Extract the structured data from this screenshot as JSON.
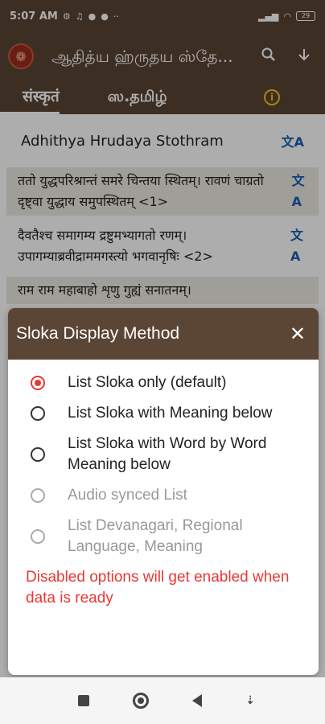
{
  "status_bar": {
    "time": "5:07 AM",
    "battery": "29"
  },
  "app_bar": {
    "title": "ஆதித்ய ஹ்ருதய ஸ்தே..."
  },
  "tabs": [
    {
      "label": "संस्कृतं"
    },
    {
      "label": "ஸ.தமிழ்"
    }
  ],
  "content": {
    "title": "Adhithya Hrudaya Stothram",
    "slokas": [
      {
        "text": "ततो युद्धपरिश्रान्तं समरे चिन्तया स्थितम्। रावणं चाग्रतो दृष्ट्वा युद्धाय समुपस्थितम् <1>"
      },
      {
        "text": "दैवतैश्च समागम्य द्रष्टुमभ्यागतो रणम्। उपागम्याब्रवीद्राममगस्त्यो भगवानृषिः <2>"
      },
      {
        "text": "राम राम महाबाहो शृणु गुह्यं सनातनम्।"
      }
    ]
  },
  "dialog": {
    "title": "Sloka Display Method",
    "options": [
      {
        "label": "List Sloka only (default)"
      },
      {
        "label": "List Sloka with Meaning below"
      },
      {
        "label": "List Sloka with Word by Word Meaning below"
      },
      {
        "label": "Audio synced List"
      },
      {
        "label": "List Devanagari, Regional Language, Meaning"
      }
    ],
    "notice": "Disabled options will get enabled when data is ready"
  }
}
